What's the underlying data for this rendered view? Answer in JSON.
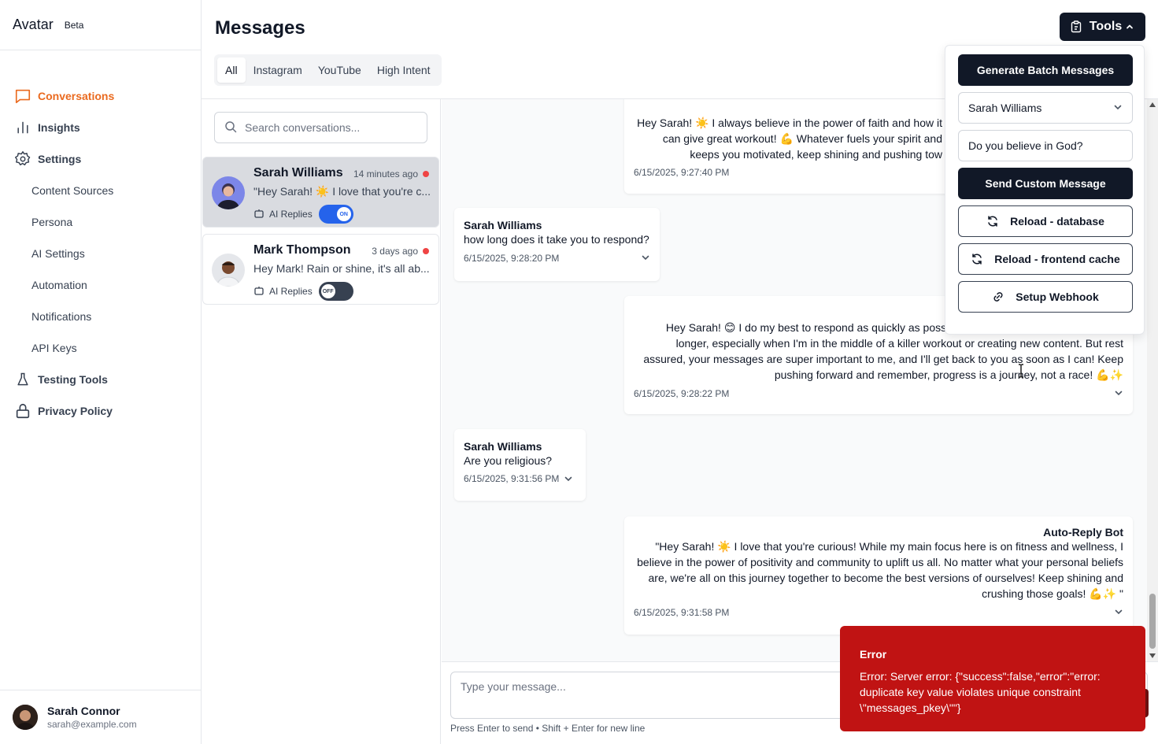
{
  "app": {
    "name": "Avatar",
    "badge": "Beta"
  },
  "sidebar": {
    "items": [
      {
        "label": "Conversations",
        "icon": "chat-bubble-icon",
        "active": true
      },
      {
        "label": "Insights",
        "icon": "bar-chart-icon"
      },
      {
        "label": "Settings",
        "icon": "gear-icon"
      }
    ],
    "sub_items": [
      "Content Sources",
      "Persona",
      "AI Settings",
      "Automation",
      "Notifications",
      "API Keys"
    ],
    "bottom_items": [
      {
        "label": "Testing Tools",
        "icon": "flask-icon"
      },
      {
        "label": "Privacy Policy",
        "icon": "lock-icon"
      }
    ],
    "user": {
      "name": "Sarah Connor",
      "email": "sarah@example.com"
    }
  },
  "page": {
    "title": "Messages"
  },
  "tabs": [
    "All",
    "Instagram",
    "YouTube",
    "High Intent"
  ],
  "search": {
    "placeholder": "Search conversations..."
  },
  "conversations": [
    {
      "name": "Sarah Williams",
      "time": "14 minutes ago",
      "preview": "\"Hey Sarah! ☀️ I love that you're c...",
      "ai_label": "AI Replies",
      "ai_state": "ON"
    },
    {
      "name": "Mark Thompson",
      "time": "3 days ago",
      "preview": "Hey Mark! Rain or shine, it's all ab...",
      "ai_label": "AI Replies",
      "ai_state": "OFF"
    }
  ],
  "messages": [
    {
      "dir": "out",
      "text": "Hey Sarah! ☀️ I always believe in the power of faith and how it can give great workout! 💪 Whatever fuels your spirit and keeps you motivated, keep shining and pushing tow",
      "time": "6/15/2025, 9:27:40 PM"
    },
    {
      "dir": "in",
      "sender": "Sarah Williams",
      "text": "how long does it take you to respond?",
      "time": "6/15/2025, 9:28:20 PM"
    },
    {
      "dir": "out",
      "text": "Hey Sarah! 😊 I do my best to respond as quickly as possible be Sometimes it might take a bit longer, especially when I'm in the middle of a killer workout or creating new content. But rest assured, your messages are super important to me, and I'll get back to you as soon as I can! Keep pushing forward and remember, progress is a journey, not a race! 💪✨",
      "time": "6/15/2025, 9:28:22 PM"
    },
    {
      "dir": "in",
      "sender": "Sarah Williams",
      "text": "Are you religious?",
      "time": "6/15/2025, 9:31:56 PM"
    },
    {
      "dir": "out",
      "sender": "Auto-Reply Bot",
      "text": "\"Hey Sarah! ☀️ I love that you're curious! While my main focus here is on fitness and wellness, I believe in the power of positivity and community to uplift us all. No matter what your personal beliefs are, we're all on this journey together to become the best versions of ourselves! Keep shining and crushing those goals! 💪✨ \"",
      "time": "6/15/2025, 9:31:58 PM"
    }
  ],
  "composer": {
    "placeholder": "Type your message...",
    "hint": "Press Enter to send • Shift + Enter for new line"
  },
  "tools": {
    "button_label": "Tools",
    "generate_batch": "Generate Batch Messages",
    "selected_user": "Sarah Williams",
    "custom_message_value": "Do you believe in God?",
    "send_custom": "Send Custom Message",
    "reload_db": "Reload - database",
    "reload_cache": "Reload - frontend cache",
    "setup_webhook": "Setup Webhook"
  },
  "toast": {
    "title": "Error",
    "body": "Error: Server error: {\"success\":false,\"error\":\"error: duplicate key value violates unique constraint \\\"messages_pkey\\\"\"}"
  },
  "colors": {
    "accent": "#ea6a1f",
    "toggle_on": "#2563eb",
    "error": "#c01313",
    "dark_button": "#111827"
  }
}
